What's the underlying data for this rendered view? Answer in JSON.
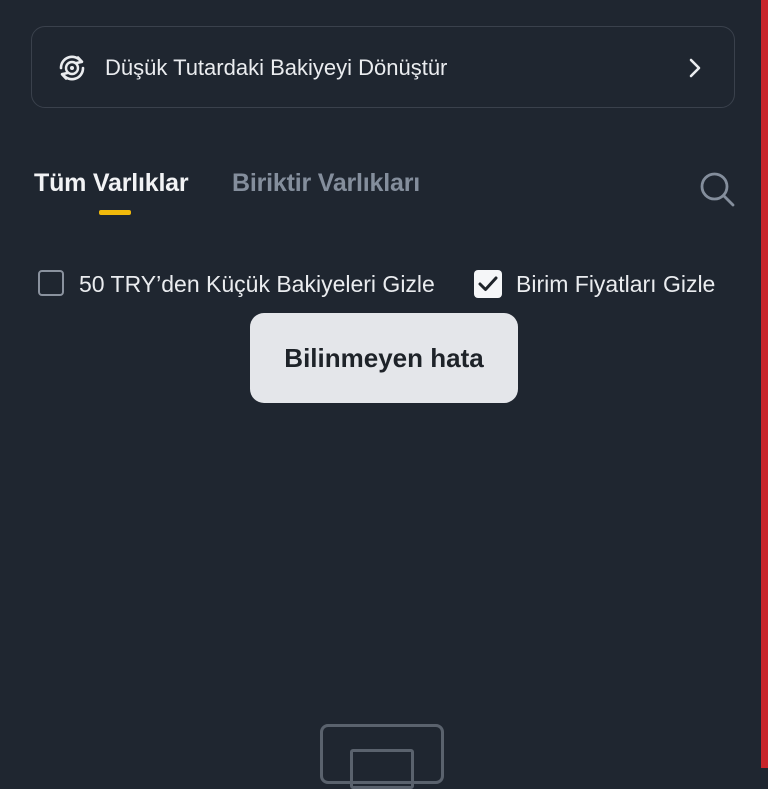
{
  "convert_card": {
    "icon": "convert-icon",
    "label": "Düşük Tutardaki Bakiyeyi Dönüştür",
    "chevron_icon": "chevron-right-icon"
  },
  "tabs": [
    {
      "label": "Tüm Varlıklar",
      "active": true
    },
    {
      "label": "Biriktir Varlıkları",
      "active": false
    }
  ],
  "search": {
    "icon": "search-icon"
  },
  "filters": {
    "hide_small": {
      "label": "50 TRY’den Küçük Bakiyeleri Gizle",
      "checked": false
    },
    "hide_unit_price": {
      "label": "Birim Fiyatları Gizle",
      "checked": true
    }
  },
  "toast": {
    "text": "Bilinmeyen hata"
  },
  "colors": {
    "background": "#1f2630",
    "accent": "#f0b90b",
    "right_bar": "#c8262b",
    "muted_text": "#848e9c"
  },
  "empty_state": {
    "icon": "empty-box-icon"
  }
}
